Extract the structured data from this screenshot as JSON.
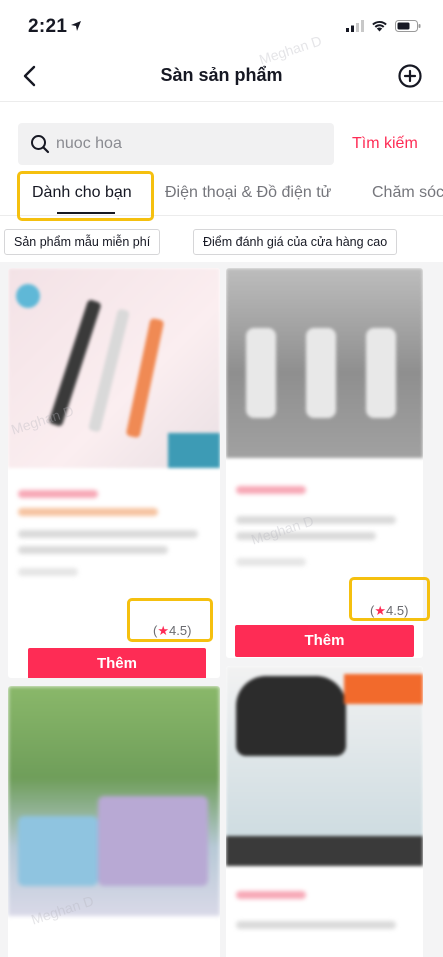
{
  "status_bar": {
    "time": "2:21"
  },
  "header": {
    "title": "Sàn sản phẩm"
  },
  "search": {
    "placeholder": "nuoc hoa",
    "button_label": "Tìm kiếm"
  },
  "tabs": [
    {
      "label": "Dành cho bạn",
      "active": true
    },
    {
      "label": "Điện thoại & Đồ điện tử",
      "active": false
    },
    {
      "label": "Chăm sóc",
      "active": false
    }
  ],
  "filters": [
    {
      "label": "Sản phẩm mẫu miễn phí"
    },
    {
      "label": "Điểm đánh giá của cửa hàng cao"
    }
  ],
  "products": [
    {
      "rating": "4.5",
      "button_label": "Thêm"
    },
    {
      "rating": "4.5",
      "button_label": "Thêm"
    }
  ],
  "colors": {
    "accent": "#fe2c55",
    "highlight": "#f5c00f"
  }
}
